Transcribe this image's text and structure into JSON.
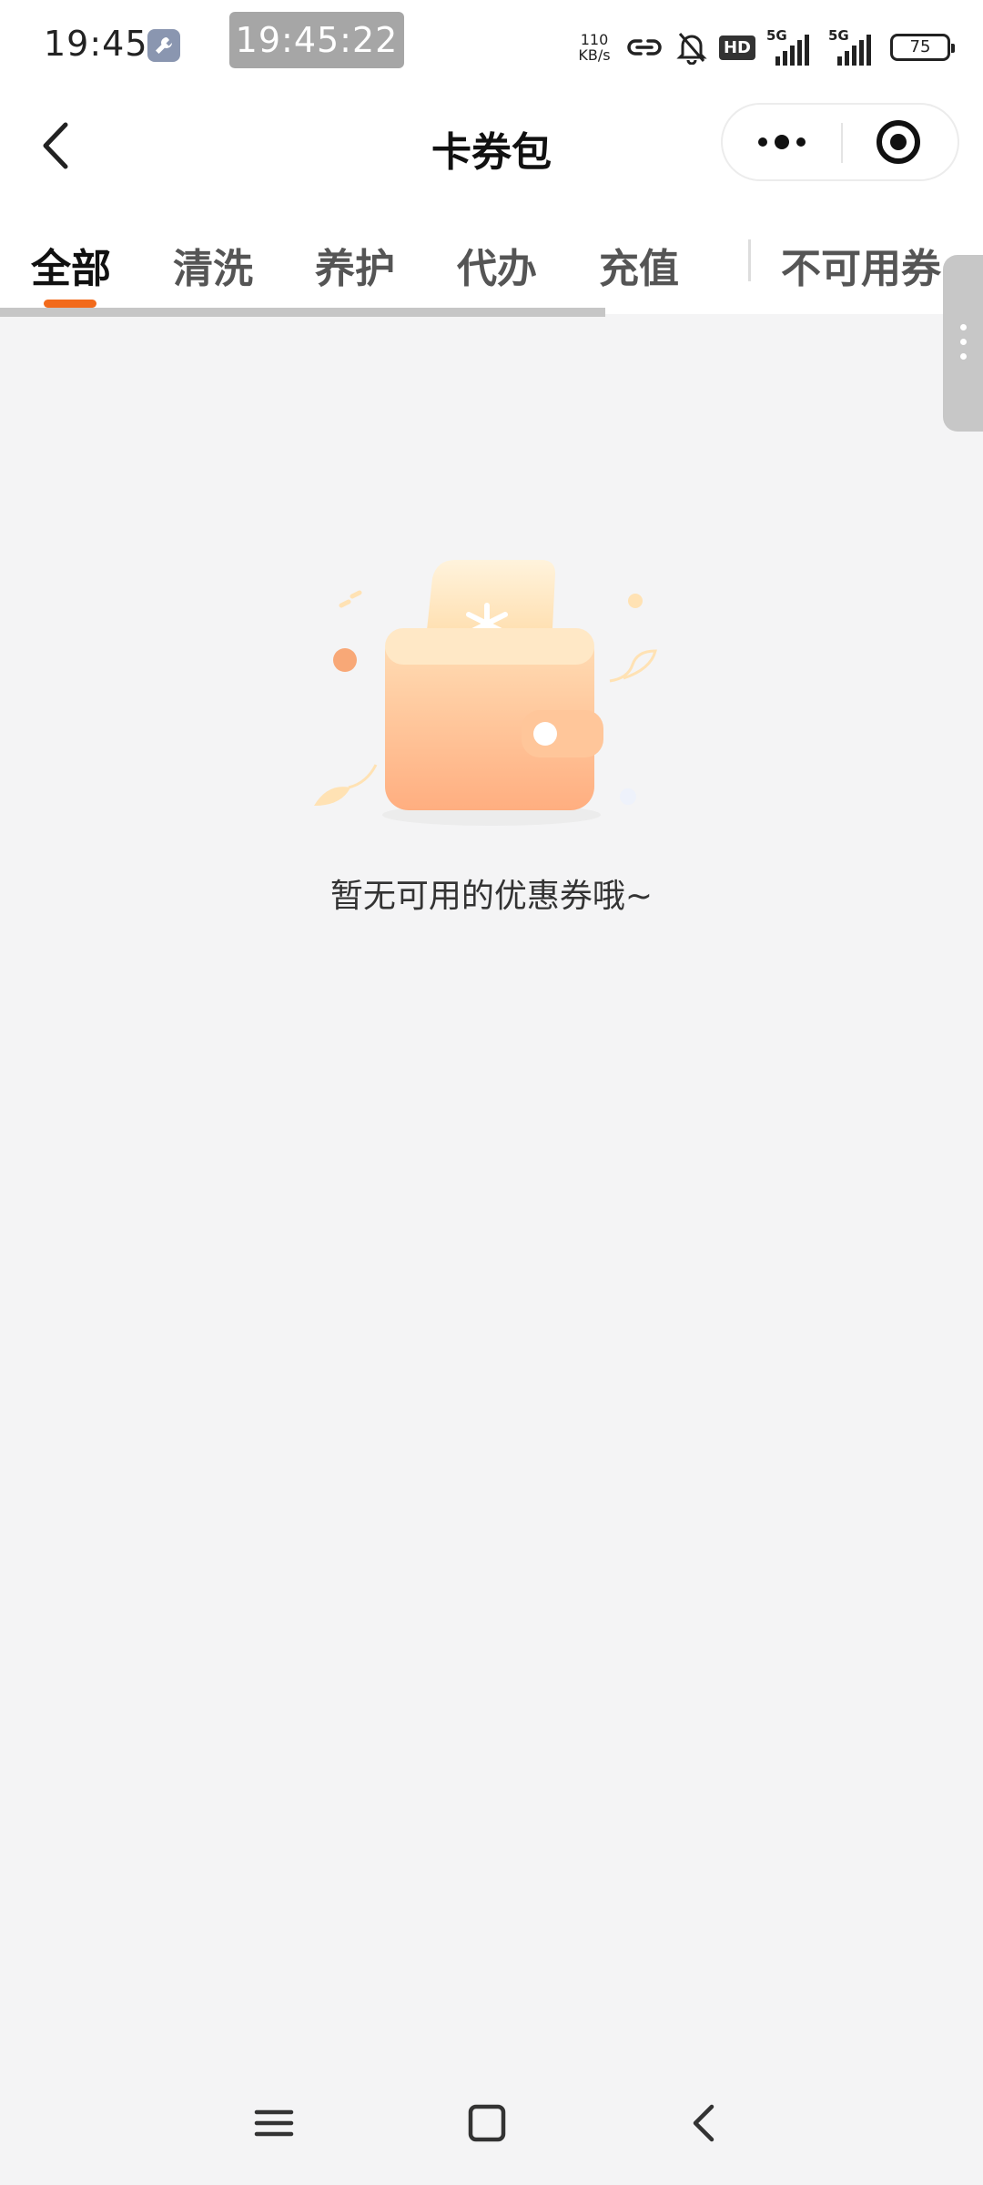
{
  "status_bar": {
    "time": "19:45",
    "recorder_time": "19:45:22",
    "net_speed_value": "110",
    "net_speed_unit": "KB/s",
    "hd_badge": "HD",
    "sim1_tag": "5G",
    "sim2_tag": "5G",
    "battery": "75"
  },
  "nav": {
    "title": "卡券包"
  },
  "tabs": [
    {
      "label": "全部",
      "active": true
    },
    {
      "label": "清洗",
      "active": false
    },
    {
      "label": "养护",
      "active": false
    },
    {
      "label": "代办",
      "active": false
    },
    {
      "label": "充值",
      "active": false
    },
    {
      "label": "不可用券",
      "active": false
    }
  ],
  "empty_state": {
    "message": "暂无可用的优惠券哦~",
    "illustration": "wallet-with-coupon-icon"
  },
  "colors": {
    "accent": "#f26a1b",
    "background": "#f4f4f5",
    "wallet": "#ffb98a"
  },
  "system_nav": {
    "icons": [
      "menu-icon",
      "home-square-icon",
      "back-chevron-icon"
    ]
  }
}
